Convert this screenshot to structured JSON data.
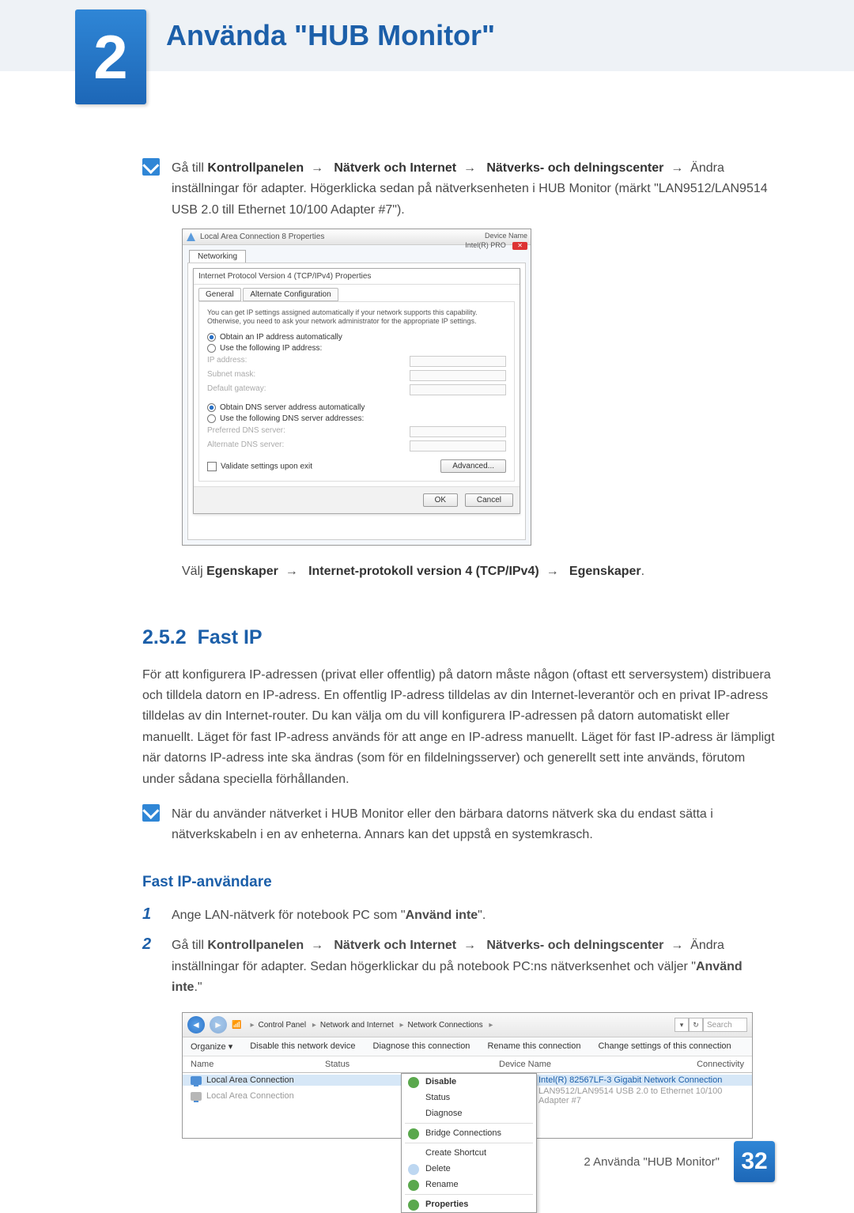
{
  "chapter_number": "2",
  "chapter_title": "Använda \"HUB Monitor\"",
  "note1": {
    "pre": "Gå till ",
    "b1": "Kontrollpanelen",
    "b2": "Nätverk och Internet",
    "b3": "Nätverks- och delningscenter",
    "tail": "Ändra inställningar för adapter. Högerklicka sedan på nätverksenheten i HUB Monitor (märkt \"LAN9512/LAN9514 USB 2.0 till Ethernet 10/100 Adapter #7\")."
  },
  "arrow": "→",
  "shot1": {
    "win_title": "Local Area Connection 8 Properties",
    "tab_networking": "Networking",
    "dev_label": "Device Name",
    "dev_value": "Intel(R) PRO",
    "inner_title": "Internet Protocol Version 4 (TCP/IPv4) Properties",
    "tab_general": "General",
    "tab_alt": "Alternate Configuration",
    "blurb": "You can get IP settings assigned automatically if your network supports this capability. Otherwise, you need to ask your network administrator for the appropriate IP settings.",
    "r_auto_ip": "Obtain an IP address automatically",
    "r_use_ip": "Use the following IP address:",
    "f_ip": "IP address:",
    "f_sub": "Subnet mask:",
    "f_gw": "Default gateway:",
    "r_auto_dns": "Obtain DNS server address automatically",
    "r_use_dns": "Use the following DNS server addresses:",
    "f_pdns": "Preferred DNS server:",
    "f_adns": "Alternate DNS server:",
    "chk_validate": "Validate settings upon exit",
    "btn_adv": "Advanced...",
    "btn_ok": "OK",
    "btn_cancel": "Cancel"
  },
  "instr1": {
    "pre": "Välj ",
    "b1": "Egenskaper",
    "b2": "Internet-protokoll version 4 (TCP/IPv4)",
    "b3": "Egenskaper",
    "tail": "."
  },
  "section": {
    "num": "2.5.2",
    "title": "Fast IP"
  },
  "para1": "För att konfigurera IP-adressen (privat eller offentlig) på datorn måste någon (oftast ett serversystem) distribuera och tilldela datorn en IP-adress. En offentlig IP-adress tilldelas av din Internet-leverantör och en privat IP-adress tilldelas av din Internet-router. Du kan välja om du vill konfigurera IP-adressen på datorn automatiskt eller manuellt. Läget för fast IP-adress används för att ange en IP-adress manuellt. Läget för fast IP-adress är lämpligt när datorns IP-adress inte ska ändras (som för en fildelningsserver) och generellt sett inte används, förutom under sådana speciella förhållanden.",
  "note2": "När du använder nätverket i HUB Monitor eller den bärbara datorns nätverk ska du endast sätta i nätverkskabeln i en av enheterna. Annars kan det uppstå en systemkrasch.",
  "h3": "Fast IP-användare",
  "steps": {
    "s1": {
      "pre": "Ange LAN-nätverk för notebook PC som \"",
      "b": "Använd inte",
      "post": "\"."
    },
    "s2": {
      "pre": "Gå till ",
      "b1": "Kontrollpanelen",
      "b2": "Nätverk och Internet",
      "b3": "Nätverks- och delningscenter",
      "mid": "Ändra inställningar för adapter. Sedan högerklickar du på notebook PC:ns nätverksenhet och väljer \"",
      "b4": "Använd inte",
      "post": ".\""
    }
  },
  "shot2": {
    "bc1": "Control Panel",
    "bc2": "Network and Internet",
    "bc3": "Network Connections",
    "search_ph": "Search",
    "tb_org": "Organize ▾",
    "tb_dis": "Disable this network device",
    "tb_diag": "Diagnose this connection",
    "tb_ren": "Rename this connection",
    "tb_chg": "Change settings of this connection",
    "col_name": "Name",
    "col_status": "Status",
    "col_dev": "Device Name",
    "col_conn": "Connectivity",
    "row1_name": "Local Area Connection",
    "row1_dev": "Intel(R) 82567LF-3 Gigabit Network Connection",
    "row2_name": "Local Area Connection",
    "row2_dev": "LAN9512/LAN9514 USB 2.0 to Ethernet 10/100 Adapter #7",
    "ctx": {
      "disable": "Disable",
      "status": "Status",
      "diag": "Diagnose",
      "bridge": "Bridge Connections",
      "shortcut": "Create Shortcut",
      "delete": "Delete",
      "rename": "Rename",
      "props": "Properties"
    }
  },
  "footer_text": "2 Använda \"HUB Monitor\"",
  "page_number": "32"
}
